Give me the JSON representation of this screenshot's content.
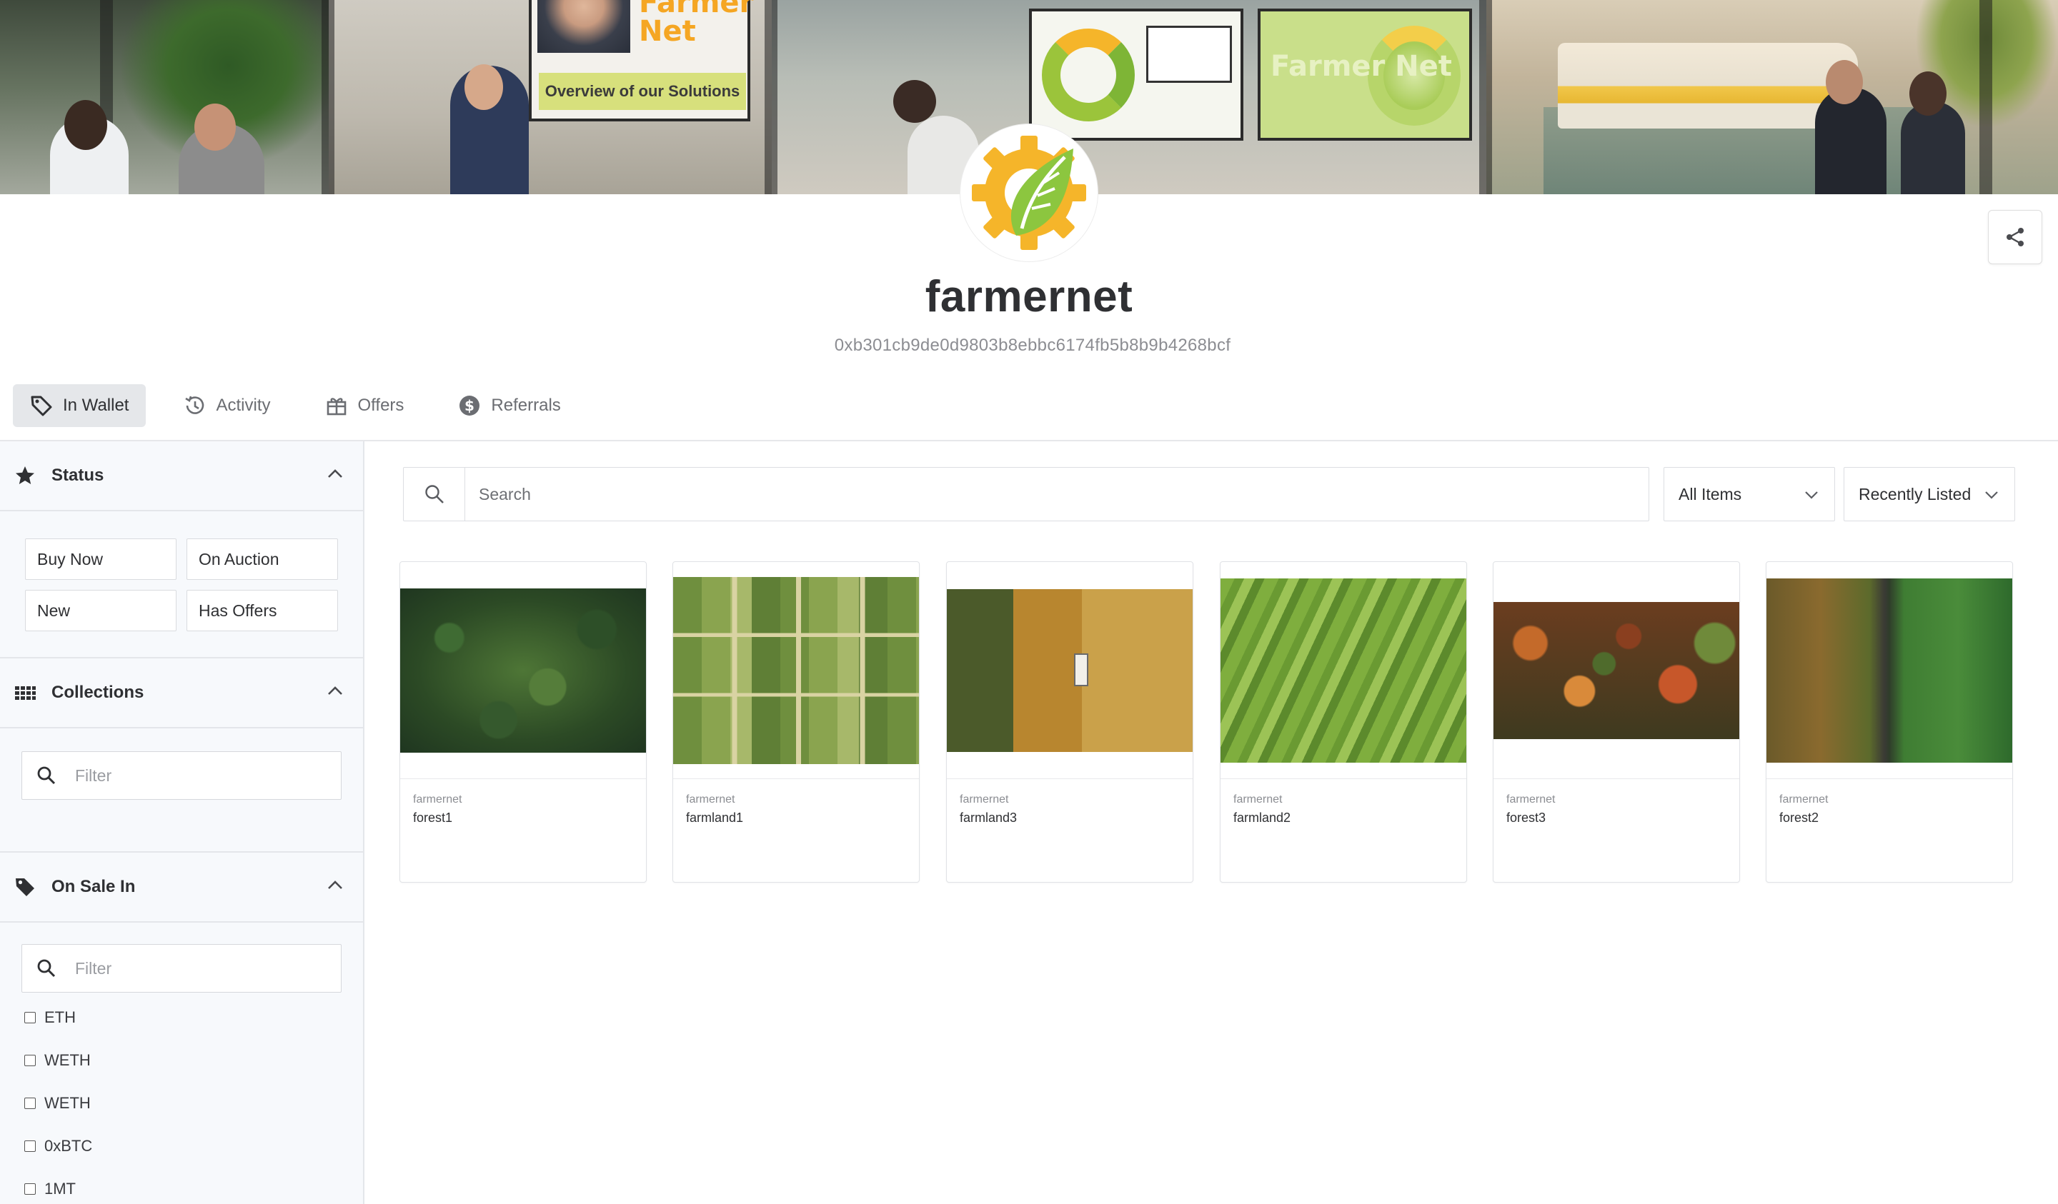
{
  "banner": {
    "screen_brand_a": "Farmer Net",
    "screen_caption": "Overview of our Solutions",
    "screen_brand_b": "Farmer Net"
  },
  "profile": {
    "name": "farmernet",
    "address": "0xb301cb9de0d9803b8ebbc6174fb5b8b9b4268bcf"
  },
  "tabs": [
    {
      "label": "In Wallet",
      "icon": "tag-icon",
      "active": true
    },
    {
      "label": "Activity",
      "icon": "history-icon",
      "active": false
    },
    {
      "label": "Offers",
      "icon": "gift-icon",
      "active": false
    },
    {
      "label": "Referrals",
      "icon": "dollar-icon",
      "active": false
    }
  ],
  "sidebar": {
    "status": {
      "title": "Status",
      "buttons": [
        "Buy Now",
        "On Auction",
        "New",
        "Has Offers"
      ]
    },
    "collections": {
      "title": "Collections",
      "filter_placeholder": "Filter"
    },
    "on_sale_in": {
      "title": "On Sale In",
      "filter_placeholder": "Filter",
      "currencies": [
        "ETH",
        "WETH",
        "WETH",
        "0xBTC",
        "1MT"
      ]
    }
  },
  "toolbar": {
    "search_placeholder": "Search",
    "items_filter": "All Items",
    "sort": "Recently Listed"
  },
  "items": [
    {
      "collection": "farmernet",
      "name": "forest1"
    },
    {
      "collection": "farmernet",
      "name": "farmland1"
    },
    {
      "collection": "farmernet",
      "name": "farmland3"
    },
    {
      "collection": "farmernet",
      "name": "farmland2"
    },
    {
      "collection": "farmernet",
      "name": "forest3"
    },
    {
      "collection": "farmernet",
      "name": "forest2"
    }
  ],
  "colors": {
    "accent_yellow": "#f5b52a",
    "leaf_green": "#8cc63f",
    "text_dark": "#2f3033",
    "text_muted": "#8c8d92",
    "sidebar_bg": "#f7f9fc"
  }
}
